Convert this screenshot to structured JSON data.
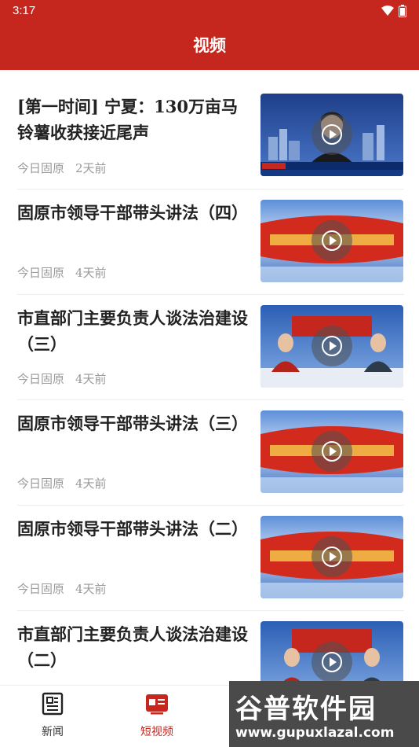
{
  "status_bar": {
    "time": "3:17"
  },
  "header": {
    "title": "视频"
  },
  "videos": [
    {
      "title": "[第一时间] 宁夏：130万亩马铃薯收获接近尾声",
      "source": "今日固原",
      "time": "2天前"
    },
    {
      "title": "固原市领导干部带头讲法（四）",
      "source": "今日固原",
      "time": "4天前"
    },
    {
      "title": "市直部门主要负责人谈法治建设（三）",
      "source": "今日固原",
      "time": "4天前"
    },
    {
      "title": "固原市领导干部带头讲法（三）",
      "source": "今日固原",
      "time": "4天前"
    },
    {
      "title": "固原市领导干部带头讲法（二）",
      "source": "今日固原",
      "time": "4天前"
    },
    {
      "title": "市直部门主要负责人谈法治建设（二）",
      "source": "",
      "time": ""
    }
  ],
  "bottom_nav": {
    "news": "新闻",
    "short_video": "短视频"
  },
  "watermark": {
    "brand": "谷普软件园",
    "url": "www.gupuxlazal.com"
  },
  "colors": {
    "brand_red": "#c5271f",
    "active_tab": "#c5271f",
    "meta_gray": "#9a9a9a"
  }
}
